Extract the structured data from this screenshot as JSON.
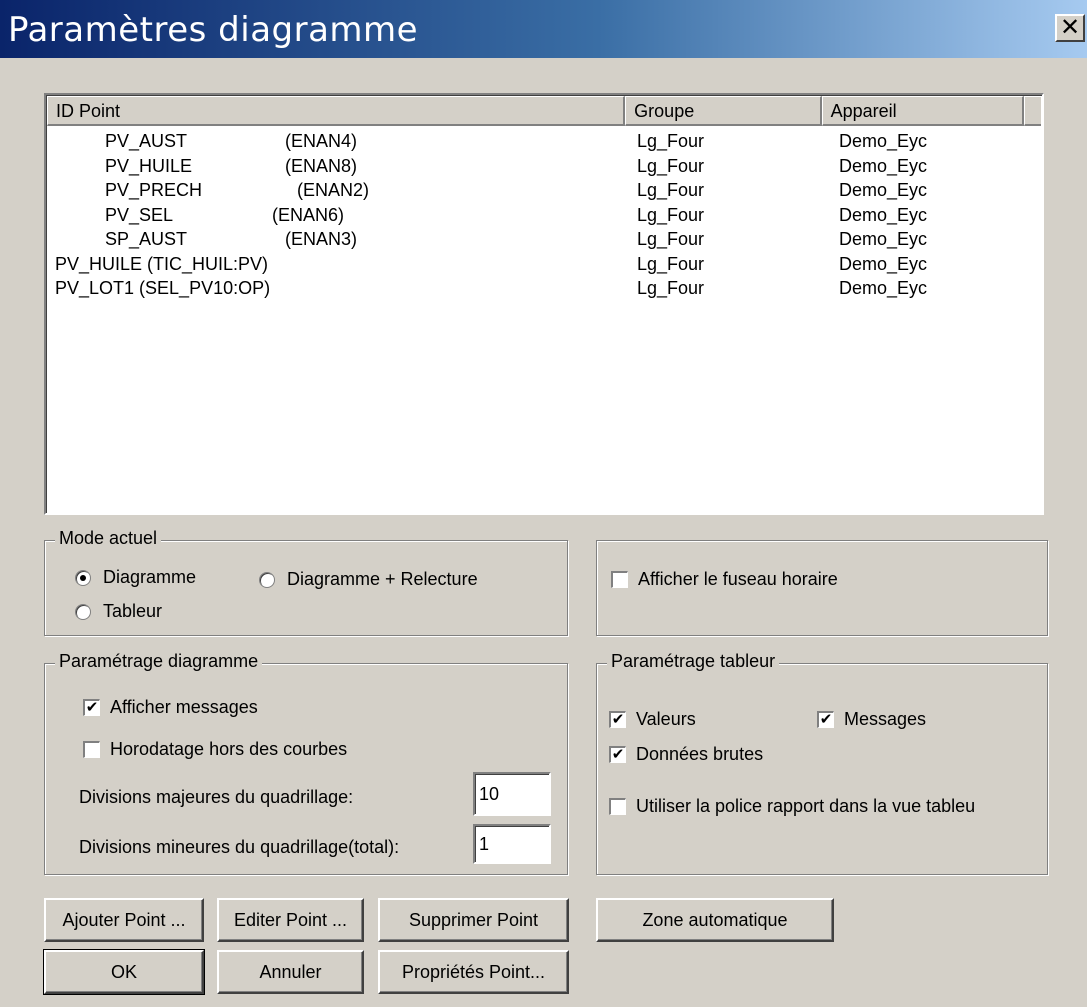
{
  "window": {
    "title": "Paramètres diagramme",
    "close_glyph": "✕"
  },
  "list": {
    "columns": [
      "ID Point",
      "Groupe",
      "Appareil"
    ],
    "rows": [
      {
        "id": "PV_AUST",
        "tag": "(ENAN4)",
        "indent": true,
        "group": "Lg_Four",
        "device": "Demo_Eyc"
      },
      {
        "id": "PV_HUILE",
        "tag": "(ENAN8)",
        "indent": true,
        "group": "Lg_Four",
        "device": "Demo_Eyc"
      },
      {
        "id": "PV_PRECH",
        "tag": "(ENAN2)",
        "indent": true,
        "group": "Lg_Four",
        "device": "Demo_Eyc"
      },
      {
        "id": "PV_SEL",
        "tag": "(ENAN6)",
        "indent": true,
        "group": "Lg_Four",
        "device": "Demo_Eyc"
      },
      {
        "id": "SP_AUST",
        "tag": "(ENAN3)",
        "indent": true,
        "group": "Lg_Four",
        "device": "Demo_Eyc"
      },
      {
        "id": "PV_HUILE (TIC_HUIL:PV)",
        "tag": "",
        "indent": false,
        "group": "Lg_Four",
        "device": "Demo_Eyc"
      },
      {
        "id": "PV_LOT1 (SEL_PV10:OP)",
        "tag": "",
        "indent": false,
        "group": "Lg_Four",
        "device": "Demo_Eyc"
      }
    ]
  },
  "mode": {
    "legend": "Mode actuel",
    "diagram_label": "Diagramme",
    "diagram_replay_label": "Diagramme + Relecture",
    "table_label": "Tableur",
    "selected": "Diagramme"
  },
  "timezone": {
    "label": "Afficher le fuseau horaire",
    "checked": false
  },
  "diagram_settings": {
    "legend": "Paramétrage diagramme",
    "show_messages_label": "Afficher messages",
    "show_messages_checked": true,
    "timestamp_label": "Horodatage hors des courbes",
    "timestamp_checked": false,
    "major_label": "Divisions majeures du quadrillage:",
    "major_value": "10",
    "minor_label": "Divisions mineures du quadrillage(total):",
    "minor_value": "1"
  },
  "table_settings": {
    "legend": "Paramétrage tableur",
    "values_label": "Valeurs",
    "values_checked": true,
    "messages_label": "Messages",
    "messages_checked": true,
    "raw_label": "Données brutes",
    "raw_checked": true,
    "font_label": "Utiliser la police rapport dans la vue tableu",
    "font_checked": false
  },
  "buttons": {
    "add_point": "Ajouter Point ...",
    "edit_point": "Editer Point ...",
    "delete_point": "Supprimer Point",
    "auto_zone": "Zone automatique",
    "ok": "OK",
    "cancel": "Annuler",
    "point_props": "Propriétés Point..."
  },
  "check_glyph": "✔"
}
